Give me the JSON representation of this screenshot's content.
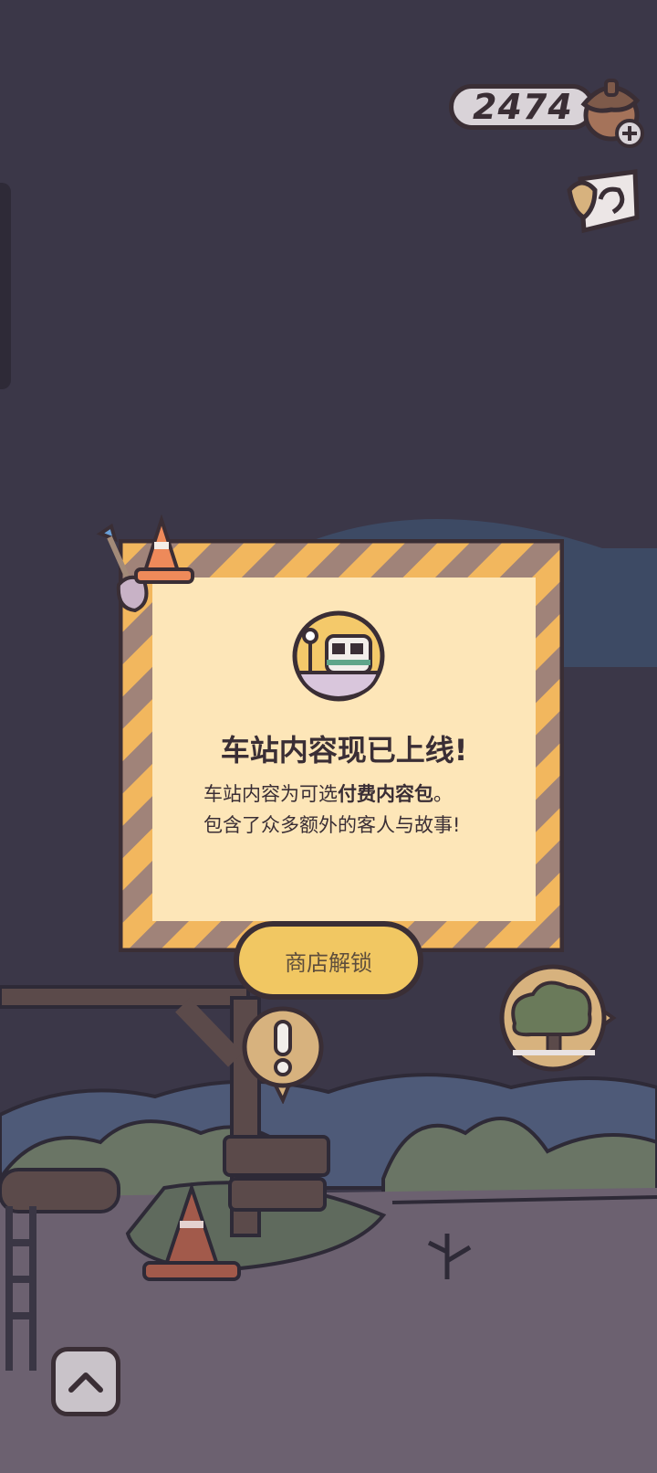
{
  "currency": {
    "amount": "2474",
    "icon": "acorn-icon",
    "add_icon": "plus-icon"
  },
  "side_buttons": {
    "ticket_icon": "ticket-icon"
  },
  "dialog": {
    "title": "车站内容现已上线!",
    "body_line1_prefix": "车站内容为可选",
    "body_line1_bold": "付费内容包",
    "body_line1_suffix": "。",
    "body_line2": "包含了众多额外的客人与故事!",
    "badge_icon": "train-icon"
  },
  "unlock_button": {
    "label": "商店解锁"
  },
  "world": {
    "tree_bubble_icon": "tree-icon",
    "alert_bubble_icon": "exclamation-icon",
    "up_icon": "chevron-up-icon"
  },
  "colors": {
    "background": "#3b3748",
    "panel": "#fde6b8",
    "stripe_yellow": "#f2b75e",
    "stripe_brown": "#a08379",
    "button": "#f1c762",
    "outline": "#3a2e35"
  }
}
